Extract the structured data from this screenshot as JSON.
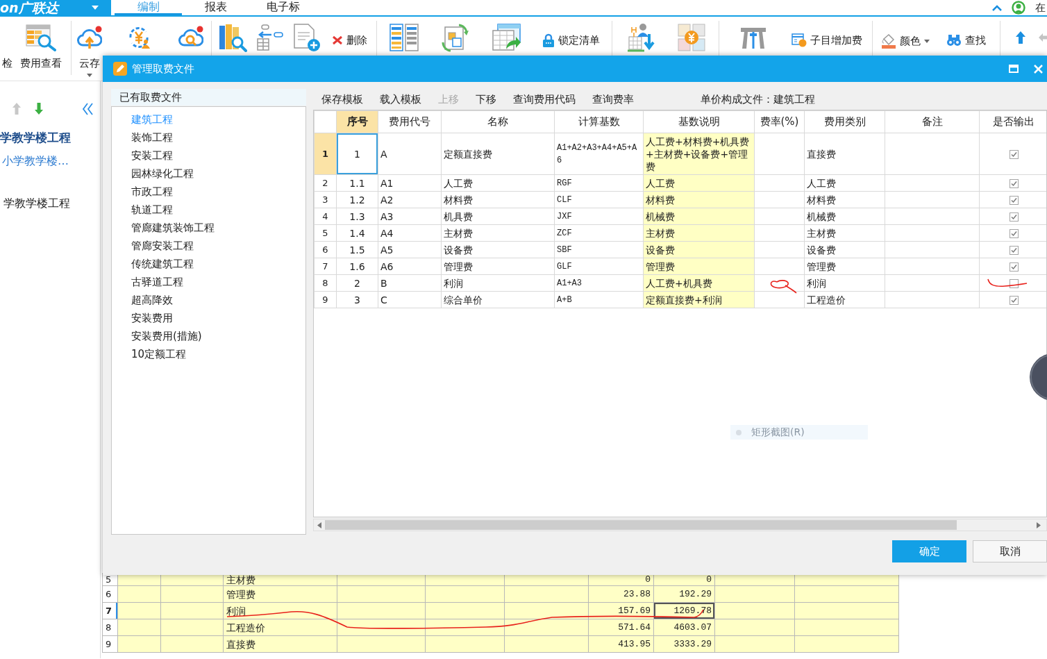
{
  "ribbon": {
    "logo": "on广联达",
    "tabs": [
      {
        "label": "编制",
        "selected": true
      },
      {
        "label": "报表",
        "selected": false
      },
      {
        "label": "电子标",
        "selected": false
      }
    ],
    "corner_text": "在"
  },
  "toolbar": {
    "groups": [
      {
        "items": [
          {
            "kind": "large",
            "label": "检"
          },
          {
            "kind": "large",
            "label": "费用查看"
          }
        ]
      },
      {
        "items": [
          {
            "kind": "large",
            "label": "云存",
            "dropdown": true
          },
          {
            "kind": "icon"
          },
          {
            "kind": "icon"
          }
        ]
      },
      {
        "items": [
          {
            "kind": "icon"
          },
          {
            "kind": "icon"
          },
          {
            "kind": "icon"
          },
          {
            "kind": "small",
            "label": "删除"
          }
        ]
      },
      {
        "items": [
          {
            "kind": "icon"
          },
          {
            "kind": "icon"
          },
          {
            "kind": "icon"
          },
          {
            "kind": "small",
            "label": "锁定清单"
          }
        ]
      },
      {
        "items": [
          {
            "kind": "icon"
          },
          {
            "kind": "icon"
          }
        ]
      },
      {
        "items": [
          {
            "kind": "icon"
          },
          {
            "kind": "small",
            "label": "子目增加费"
          }
        ]
      },
      {
        "items": [
          {
            "kind": "small",
            "label": "颜色",
            "dropdown": true
          },
          {
            "kind": "small",
            "label": "查找"
          }
        ]
      },
      {
        "items": [
          {
            "kind": "icon",
            "disabled": false
          },
          {
            "kind": "icon",
            "disabled": true
          }
        ]
      }
    ]
  },
  "project_tree": {
    "nav_buttons": [
      {
        "kind": "up",
        "disabled": true
      },
      {
        "kind": "down",
        "disabled": false
      }
    ],
    "items": [
      {
        "kind": "project",
        "label": "学教学楼工程",
        "selected": false
      },
      {
        "kind": "section",
        "label": "小学教学楼…",
        "selected": true
      },
      {
        "kind": "unit",
        "label": "学教学楼工程",
        "selected": false
      }
    ]
  },
  "dialog": {
    "title": "管理取费文件",
    "file_list": {
      "header": "已有取费文件",
      "items": [
        {
          "label": "建筑工程",
          "selected": true
        },
        {
          "label": "装饰工程",
          "selected": false
        },
        {
          "label": "安装工程",
          "selected": false
        },
        {
          "label": "园林绿化工程",
          "selected": false
        },
        {
          "label": "市政工程",
          "selected": false
        },
        {
          "label": "轨道工程",
          "selected": false
        },
        {
          "label": "管廊建筑装饰工程",
          "selected": false
        },
        {
          "label": "管廊安装工程",
          "selected": false
        },
        {
          "label": "传统建筑工程",
          "selected": false
        },
        {
          "label": "古驿道工程",
          "selected": false
        },
        {
          "label": "超高降效",
          "selected": false
        },
        {
          "label": "安装费用",
          "selected": false
        },
        {
          "label": "安装费用(措施)",
          "selected": false
        },
        {
          "label": "10定额工程",
          "selected": false
        }
      ]
    },
    "toolbar": [
      {
        "label": "保存模板",
        "disabled": false
      },
      {
        "label": "载入模板",
        "disabled": false
      },
      {
        "label": "上移",
        "disabled": true
      },
      {
        "label": "下移",
        "disabled": false
      },
      {
        "label": "查询费用代码",
        "disabled": false
      },
      {
        "label": "查询费率",
        "disabled": false
      }
    ],
    "template_file": "单价构成文件：建筑工程",
    "table": {
      "columns": [
        {
          "label": "序号",
          "selected": true,
          "shaded": false
        },
        {
          "label": "费用代号",
          "selected": false,
          "shaded": false
        },
        {
          "label": "名称",
          "selected": false,
          "shaded": false
        },
        {
          "label": "计算基数",
          "selected": false,
          "shaded": false
        },
        {
          "label": "基数说明",
          "selected": false,
          "shaded": true
        },
        {
          "label": "费率(%)",
          "selected": false,
          "shaded": false
        },
        {
          "label": "费用类别",
          "selected": false,
          "shaded": false
        },
        {
          "label": "备注",
          "selected": false,
          "shaded": false
        },
        {
          "label": "是否输出",
          "selected": false,
          "shaded": false
        }
      ],
      "rows": [
        {
          "row_number": "1",
          "selected": true,
          "seq": "1",
          "code": "A",
          "name": "定额直接费",
          "base": "A1+A2+A3+A4+A5+A6",
          "base_desc": "人工费+材料费+机具费+主材费+设备费+管理费",
          "category": "直接费",
          "output": true,
          "annotated": false
        },
        {
          "row_number": "2",
          "selected": false,
          "seq": "1.1",
          "code": "A1",
          "name": "人工费",
          "base": "RGF",
          "base_desc": "人工费",
          "category": "人工费",
          "output": true,
          "annotated": false
        },
        {
          "row_number": "3",
          "selected": false,
          "seq": "1.2",
          "code": "A2",
          "name": "材料费",
          "base": "CLF",
          "base_desc": "材料费",
          "category": "材料费",
          "output": true,
          "annotated": false
        },
        {
          "row_number": "4",
          "selected": false,
          "seq": "1.3",
          "code": "A3",
          "name": "机具费",
          "base": "JXF",
          "base_desc": "机械费",
          "category": "机械费",
          "output": true,
          "annotated": false
        },
        {
          "row_number": "5",
          "selected": false,
          "seq": "1.4",
          "code": "A4",
          "name": "主材费",
          "base": "ZCF",
          "base_desc": "主材费",
          "category": "主材费",
          "output": true,
          "annotated": false
        },
        {
          "row_number": "6",
          "selected": false,
          "seq": "1.5",
          "code": "A5",
          "name": "设备费",
          "base": "SBF",
          "base_desc": "设备费",
          "category": "设备费",
          "output": true,
          "annotated": false
        },
        {
          "row_number": "7",
          "selected": false,
          "seq": "1.6",
          "code": "A6",
          "name": "管理费",
          "base": "GLF",
          "base_desc": "管理费",
          "category": "管理费",
          "output": true,
          "annotated": false
        },
        {
          "row_number": "8",
          "selected": false,
          "seq": "2",
          "code": "B",
          "name": "利润",
          "base": "A1+A3",
          "base_desc": "人工费+机具费",
          "category": "利润",
          "output": false,
          "annotated": true
        },
        {
          "row_number": "9",
          "selected": false,
          "seq": "3",
          "code": "C",
          "name": "综合单价",
          "base": "A+B",
          "base_desc": "定额直接费+利润",
          "category": "工程造价",
          "output": true,
          "annotated": false
        }
      ]
    },
    "faded_menu_item": {
      "label": "矩形截图(R)"
    },
    "buttons": [
      {
        "kind": "primary",
        "label": "确定"
      },
      {
        "kind": "secondary",
        "label": "取消"
      }
    ]
  },
  "sheet": {
    "rows": [
      {
        "row_number": "5",
        "name": "主材费",
        "value_1": "0",
        "value_2": "0",
        "selected": false,
        "annotated": false
      },
      {
        "row_number": "6",
        "name": "管理费",
        "value_1": "23.88",
        "value_2": "192.29",
        "selected": false,
        "annotated": false
      },
      {
        "row_number": "7",
        "name": "利润",
        "value_1": "157.69",
        "value_2": "1269.78",
        "selected": true,
        "annotated": true
      },
      {
        "row_number": "8",
        "name": "工程造价",
        "value_1": "571.64",
        "value_2": "4603.07",
        "selected": false,
        "annotated": false
      },
      {
        "row_number": "9",
        "name": "直接费",
        "value_1": "413.95",
        "value_2": "3333.29",
        "selected": false,
        "annotated": false
      }
    ]
  }
}
